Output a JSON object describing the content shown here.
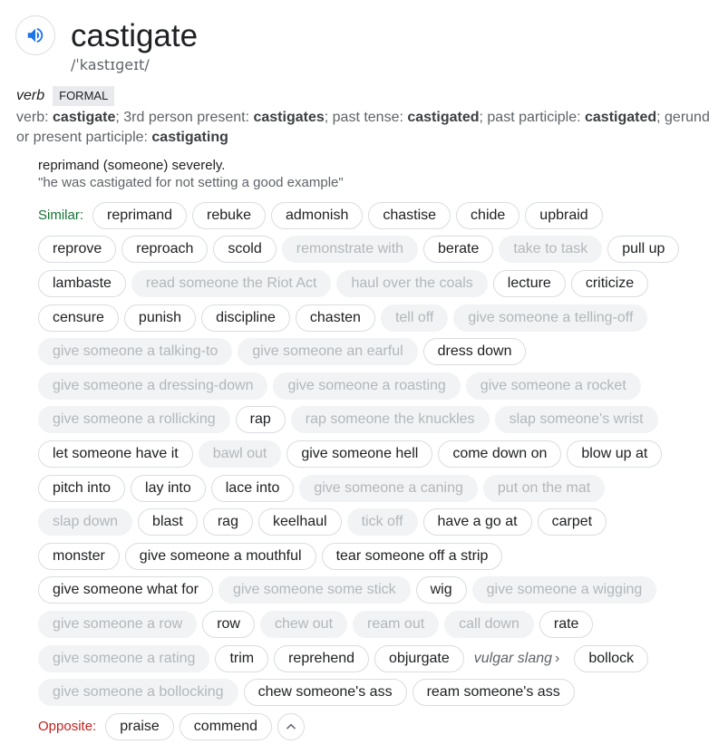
{
  "entry": {
    "word": "castigate",
    "phonetic": "/ˈkastɪɡeɪt/",
    "speaker_icon": "volume-icon"
  },
  "sense": {
    "part_of_speech": "verb",
    "register": "FORMAL",
    "forms": [
      {
        "text": "verb: ",
        "bold": false
      },
      {
        "text": "castigate",
        "bold": true
      },
      {
        "text": "; 3rd person present: ",
        "bold": false
      },
      {
        "text": "castigates",
        "bold": true
      },
      {
        "text": "; past tense: ",
        "bold": false
      },
      {
        "text": "castigated",
        "bold": true
      },
      {
        "text": "; past participle: ",
        "bold": false
      },
      {
        "text": "castigated",
        "bold": true
      },
      {
        "text": "; gerund or present participle: ",
        "bold": false
      },
      {
        "text": "castigating",
        "bold": true
      }
    ],
    "definition": "reprimand (someone) severely.",
    "example": "\"he was castigated for not setting a good example\""
  },
  "similar_label": "Similar:",
  "opposite_label": "Opposite:",
  "slang_arrow": "›",
  "collapse_icon": "chevron-up-icon",
  "colors": {
    "accent": "#1a73e8",
    "similar": "#137333",
    "opposite": "#c5221f"
  },
  "rows": [
    {
      "label": "similar",
      "chips": [
        {
          "t": "reprimand"
        },
        {
          "t": "rebuke"
        },
        {
          "t": "admonish"
        },
        {
          "t": "chastise"
        },
        {
          "t": "chide"
        },
        {
          "t": "upbraid"
        }
      ]
    },
    {
      "chips": [
        {
          "t": "reprove"
        },
        {
          "t": "reproach"
        },
        {
          "t": "scold"
        },
        {
          "t": "remonstrate with",
          "d": true
        },
        {
          "t": "berate"
        },
        {
          "t": "take to task",
          "d": true
        },
        {
          "t": "pull up"
        }
      ]
    },
    {
      "chips": [
        {
          "t": "lambaste"
        },
        {
          "t": "read someone the Riot Act",
          "d": true
        },
        {
          "t": "haul over the coals",
          "d": true
        },
        {
          "t": "lecture"
        },
        {
          "t": "criticize"
        }
      ]
    },
    {
      "chips": [
        {
          "t": "censure"
        },
        {
          "t": "punish"
        },
        {
          "t": "discipline"
        },
        {
          "t": "chasten"
        },
        {
          "t": "tell off",
          "d": true
        },
        {
          "t": "give someone a telling-off",
          "d": true
        }
      ]
    },
    {
      "chips": [
        {
          "t": "give someone a talking-to",
          "d": true
        },
        {
          "t": "give someone an earful",
          "d": true
        },
        {
          "t": "dress down"
        }
      ]
    },
    {
      "chips": [
        {
          "t": "give someone a dressing-down",
          "d": true
        },
        {
          "t": "give someone a roasting",
          "d": true
        },
        {
          "t": "give someone a rocket",
          "d": true
        }
      ]
    },
    {
      "chips": [
        {
          "t": "give someone a rollicking",
          "d": true
        },
        {
          "t": "rap"
        },
        {
          "t": "rap someone the knuckles",
          "d": true
        },
        {
          "t": "slap someone's wrist",
          "d": true
        }
      ]
    },
    {
      "chips": [
        {
          "t": "let someone have it"
        },
        {
          "t": "bawl out",
          "d": true
        },
        {
          "t": "give someone hell"
        },
        {
          "t": "come down on"
        },
        {
          "t": "blow up at"
        }
      ]
    },
    {
      "chips": [
        {
          "t": "pitch into"
        },
        {
          "t": "lay into"
        },
        {
          "t": "lace into"
        },
        {
          "t": "give someone a caning",
          "d": true
        },
        {
          "t": "put on the mat",
          "d": true
        }
      ]
    },
    {
      "chips": [
        {
          "t": "slap down",
          "d": true
        },
        {
          "t": "blast"
        },
        {
          "t": "rag"
        },
        {
          "t": "keelhaul"
        },
        {
          "t": "tick off",
          "d": true
        },
        {
          "t": "have a go at"
        },
        {
          "t": "carpet"
        }
      ]
    },
    {
      "chips": [
        {
          "t": "monster"
        },
        {
          "t": "give someone a mouthful"
        },
        {
          "t": "tear someone off a strip"
        }
      ]
    },
    {
      "chips": [
        {
          "t": "give someone what for"
        },
        {
          "t": "give someone some stick",
          "d": true
        },
        {
          "t": "wig"
        },
        {
          "t": "give someone a wigging",
          "d": true
        }
      ]
    },
    {
      "chips": [
        {
          "t": "give someone a row",
          "d": true
        },
        {
          "t": "row"
        },
        {
          "t": "chew out",
          "d": true
        },
        {
          "t": "ream out",
          "d": true
        },
        {
          "t": "call down",
          "d": true
        },
        {
          "t": "rate"
        }
      ]
    },
    {
      "chips": [
        {
          "t": "give someone a rating",
          "d": true
        },
        {
          "t": "trim"
        },
        {
          "t": "reprehend"
        },
        {
          "t": "objurgate"
        },
        {
          "t": "vulgar slang",
          "s": true
        },
        {
          "t": "bollock"
        }
      ]
    },
    {
      "chips": [
        {
          "t": "give someone a bollocking",
          "d": true
        },
        {
          "t": "chew someone's ass"
        },
        {
          "t": "ream someone's ass"
        }
      ]
    },
    {
      "label": "opposite",
      "chips": [
        {
          "t": "praise"
        },
        {
          "t": "commend"
        }
      ],
      "collapse": true
    }
  ]
}
